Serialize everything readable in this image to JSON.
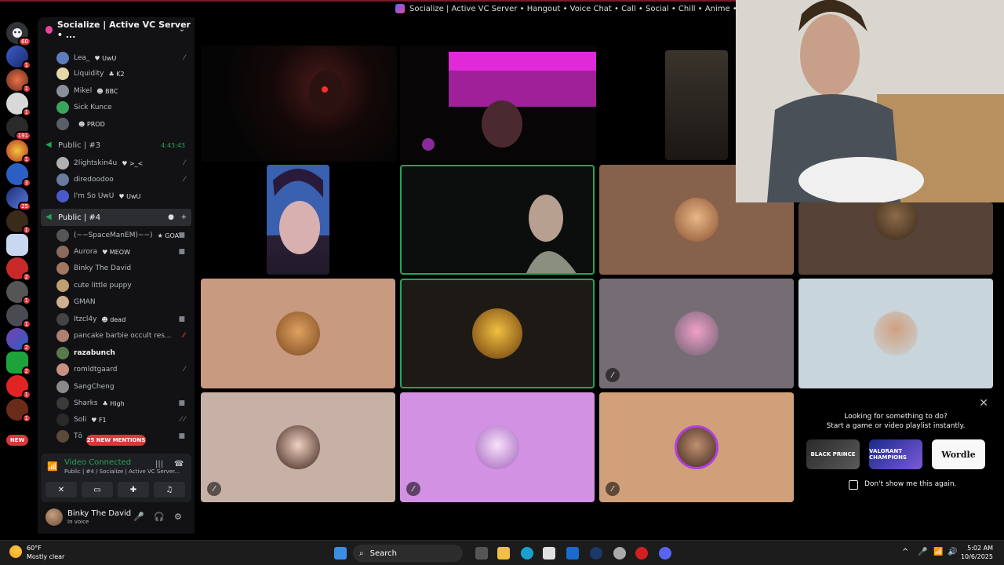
{
  "window": {
    "title": "Socialize | Active VC Server • Hangout • Voice Chat • Call • Social • Chill • Anime • Memes • Emojis"
  },
  "rail": {
    "badges": [
      "60",
      "1",
      "1",
      "1",
      "191",
      "1",
      "3",
      "25",
      "1",
      "2",
      "1",
      "1",
      "2",
      "2",
      "1",
      "1"
    ],
    "new_label": "NEW"
  },
  "server": {
    "name": "Socialize | Active VC Server • ..."
  },
  "channels": [
    {
      "name": "Public | #3",
      "timer": "4:43:43",
      "members": [
        {
          "name": "2lightskin4u",
          "tag": "♥ >_<"
        },
        {
          "name": "diredoodoo",
          "tag": ""
        },
        {
          "name": "I'm So UwU",
          "tag": "♥ UwU"
        }
      ]
    },
    {
      "name": "Public | #4",
      "members": [
        {
          "name": "(~~SpaceManEM)~~)",
          "tag": "★ GOAT"
        },
        {
          "name": "Aurora",
          "tag": "♥ MEOW"
        },
        {
          "name": "Binky The David",
          "tag": ""
        },
        {
          "name": "cute little puppy",
          "tag": ""
        },
        {
          "name": "GMAN",
          "tag": ""
        },
        {
          "name": "Itzcl4y",
          "tag": "☻ dead"
        },
        {
          "name": "pancake barbie occult res...",
          "tag": ""
        },
        {
          "name": "razabunch",
          "tag": ""
        },
        {
          "name": "romldtgaard",
          "tag": ""
        },
        {
          "name": "SangCheng",
          "tag": ""
        },
        {
          "name": "Sharks",
          "tag": "♣ High"
        },
        {
          "name": "Soli",
          "tag": "♥ F1"
        },
        {
          "name": "Tō",
          "tag": ""
        }
      ]
    }
  ],
  "top_members": [
    {
      "name": "Lea_",
      "tag": "♥ UwU"
    },
    {
      "name": "Liquidity",
      "tag": "♣ K2"
    },
    {
      "name": "Mikel",
      "tag": "☻ BBC"
    },
    {
      "name": "Sick Kunce",
      "tag": ""
    },
    {
      "name": "",
      "tag": "☻ PROD"
    }
  ],
  "mentions_label": "25 NEW MENTIONS",
  "voice": {
    "status": "Video Connected",
    "location": "Public | #4 / Socialize | Active VC Server..."
  },
  "user": {
    "name": "Binky The David",
    "status": "In voice"
  },
  "activity": {
    "title": "Looking for something to do?",
    "subtitle": "Start a game or video playlist instantly.",
    "cards": [
      "BLACK PRINCE",
      "VALORANT CHAMPIONS",
      "Wordle"
    ],
    "checkbox_label": "Don't show me this again."
  },
  "taskbar": {
    "temp": "60°F",
    "weather": "Mostly clear",
    "search": "Search",
    "time": "5:02 AM",
    "date": "10/6/2025"
  },
  "colors": {
    "green": "#23a55a",
    "red_badge": "#da373c",
    "sidebar_bg": "#121214"
  }
}
